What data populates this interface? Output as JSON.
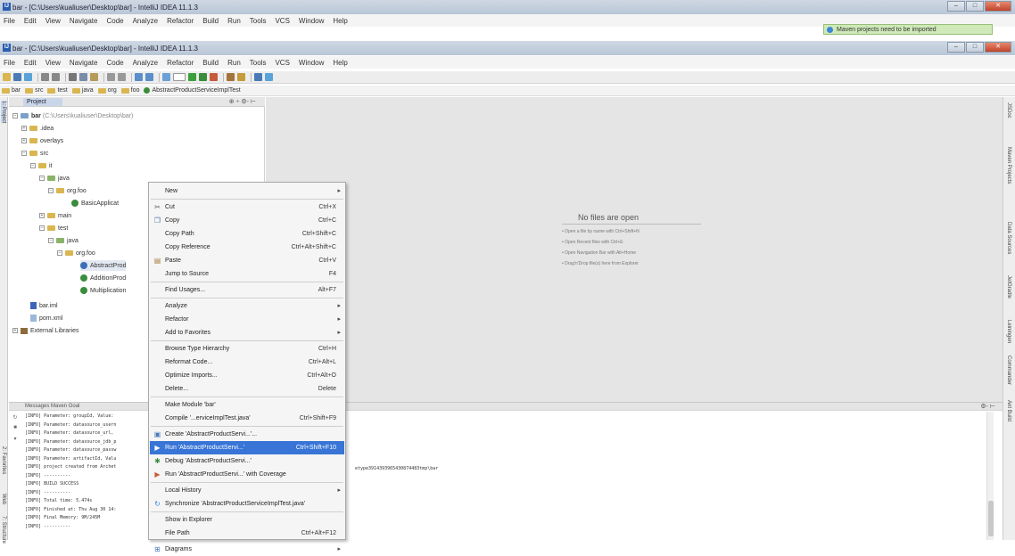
{
  "window1": {
    "title": "bar - [C:\\Users\\kualiuser\\Desktop\\bar] - IntelliJ IDEA 11.1.3"
  },
  "window2": {
    "title": "bar - [C:\\Users\\kualiuser\\Desktop\\bar] - IntelliJ IDEA 11.1.3"
  },
  "menubar": {
    "items": [
      "File",
      "Edit",
      "View",
      "Navigate",
      "Code",
      "Analyze",
      "Refactor",
      "Build",
      "Run",
      "Tools",
      "VCS",
      "Window",
      "Help"
    ]
  },
  "notification": {
    "text": "Maven projects need to be imported"
  },
  "navbar": {
    "crumbs": [
      "bar",
      "src",
      "test",
      "java",
      "org",
      "foo",
      "AbstractProductServiceImplTest"
    ]
  },
  "project_panel": {
    "tab": "Project",
    "tools": "⊕ ÷  ⚙-  ⊢",
    "tree": {
      "root_name": "bar",
      "root_path": "(C:\\Users\\kualiuser\\Desktop\\bar)",
      "idea": ".idea",
      "overlays": "overlays",
      "src": "src",
      "it": "it",
      "it_java": "java",
      "it_orgfoo": "org.foo",
      "it_class": "BasicApplicat",
      "main": "main",
      "test": "test",
      "test_java": "java",
      "test_orgfoo": "org.foo",
      "test_class1": "AbstractProd",
      "test_class2": "AdditionProd",
      "test_class3": "Multiplication",
      "bar_iml": "bar.iml",
      "pom_xml": "pom.xml",
      "external_libraries": "External Libraries"
    }
  },
  "editor": {
    "empty_title": "No files are open",
    "hints": [
      "• Open a file by name with Ctrl+Shift+N",
      "• Open Recent files with Ctrl+E",
      "• Open Navigation Bar with Alt+Home",
      "• Drag'n'Drop file(s) here from Explorer"
    ]
  },
  "bottom_panel": {
    "title": "Messages  Maven Goal",
    "tools": "⚙-  ⊢",
    "lines": [
      "[INFO] Parameter: groupId, Value:",
      "[INFO] Parameter: datasource_usern",
      "[INFO] Parameter: datasource_url,",
      "[INFO] Parameter: datasource_jdb_p",
      "[INFO] Parameter: datasource_passw",
      "[INFO] Parameter: artifactId, Valu",
      "[INFO] project created from Archet",
      "[INFO] ----------",
      "[INFO] BUILD SUCCESS",
      "[INFO] ----------",
      "[INFO] Total time: 5.474s",
      "[INFO] Finished at: Thu Aug 30 14:",
      "[INFO] Final Memory: 9M/245M",
      "[INFO] ----------"
    ],
    "tail_text": "etype3914393965430874483tmp\\bar"
  },
  "left_strip": {
    "tab1": "1: Project",
    "tab2": "2: Favorites",
    "tab3": "Web",
    "tab4": "7: Structure"
  },
  "right_strip": {
    "tabs": [
      "JSDoc",
      "Maven Projects",
      "Data Sources",
      "JetGradle",
      "Leiningen",
      "Commander",
      "Ant Build"
    ]
  },
  "context_menu": {
    "items": [
      {
        "label": "New",
        "shortcut": "",
        "icon": "",
        "submenu": true
      },
      {
        "label": "Cut",
        "shortcut": "Ctrl+X",
        "icon": "cut-icon"
      },
      {
        "label": "Copy",
        "shortcut": "Ctrl+C",
        "icon": "copy-icon"
      },
      {
        "label": "Copy Path",
        "shortcut": "Ctrl+Shift+C",
        "icon": ""
      },
      {
        "label": "Copy Reference",
        "shortcut": "Ctrl+Alt+Shift+C",
        "icon": ""
      },
      {
        "label": "Paste",
        "shortcut": "Ctrl+V",
        "icon": "paste-icon"
      },
      {
        "label": "Jump to Source",
        "shortcut": "F4",
        "icon": ""
      },
      {
        "label": "Find Usages...",
        "shortcut": "Alt+F7",
        "icon": ""
      },
      {
        "label": "Analyze",
        "shortcut": "",
        "icon": "",
        "submenu": true
      },
      {
        "label": "Refactor",
        "shortcut": "",
        "icon": "",
        "submenu": true
      },
      {
        "label": "Add to Favorites",
        "shortcut": "",
        "icon": "",
        "submenu": true
      },
      {
        "label": "Browse Type Hierarchy",
        "shortcut": "Ctrl+H",
        "icon": ""
      },
      {
        "label": "Reformat Code...",
        "shortcut": "Ctrl+Alt+L",
        "icon": ""
      },
      {
        "label": "Optimize Imports...",
        "shortcut": "Ctrl+Alt+O",
        "icon": ""
      },
      {
        "label": "Delete...",
        "shortcut": "Delete",
        "icon": ""
      },
      {
        "label": "Make Module 'bar'",
        "shortcut": "",
        "icon": ""
      },
      {
        "label": "Compile '...erviceImplTest.java'",
        "shortcut": "Ctrl+Shift+F9",
        "icon": ""
      },
      {
        "label": "Create 'AbstractProductServi...'...",
        "shortcut": "",
        "icon": "create-config-icon"
      },
      {
        "label": "Run 'AbstractProductServi...'",
        "shortcut": "Ctrl+Shift+F10",
        "icon": "run-icon",
        "selected": true
      },
      {
        "label": "Debug 'AbstractProductServi...'",
        "shortcut": "",
        "icon": "debug-icon"
      },
      {
        "label": "Run 'AbstractProductServi...' with Coverage",
        "shortcut": "",
        "icon": "coverage-icon"
      },
      {
        "label": "Local History",
        "shortcut": "",
        "icon": "",
        "submenu": true
      },
      {
        "label": "Synchronize 'AbstractProductServiceImplTest.java'",
        "shortcut": "",
        "icon": "sync-icon"
      },
      {
        "label": "Show in Explorer",
        "shortcut": "",
        "icon": ""
      },
      {
        "label": "File Path",
        "shortcut": "Ctrl+Alt+F12",
        "icon": ""
      },
      {
        "label": "Diagrams",
        "shortcut": "",
        "icon": "diagram-icon",
        "submenu": true
      }
    ]
  },
  "colors": {
    "selection": "#3875d7",
    "editor_bg": "#e5e5e5",
    "notification_bg": "#cfe9b8"
  }
}
